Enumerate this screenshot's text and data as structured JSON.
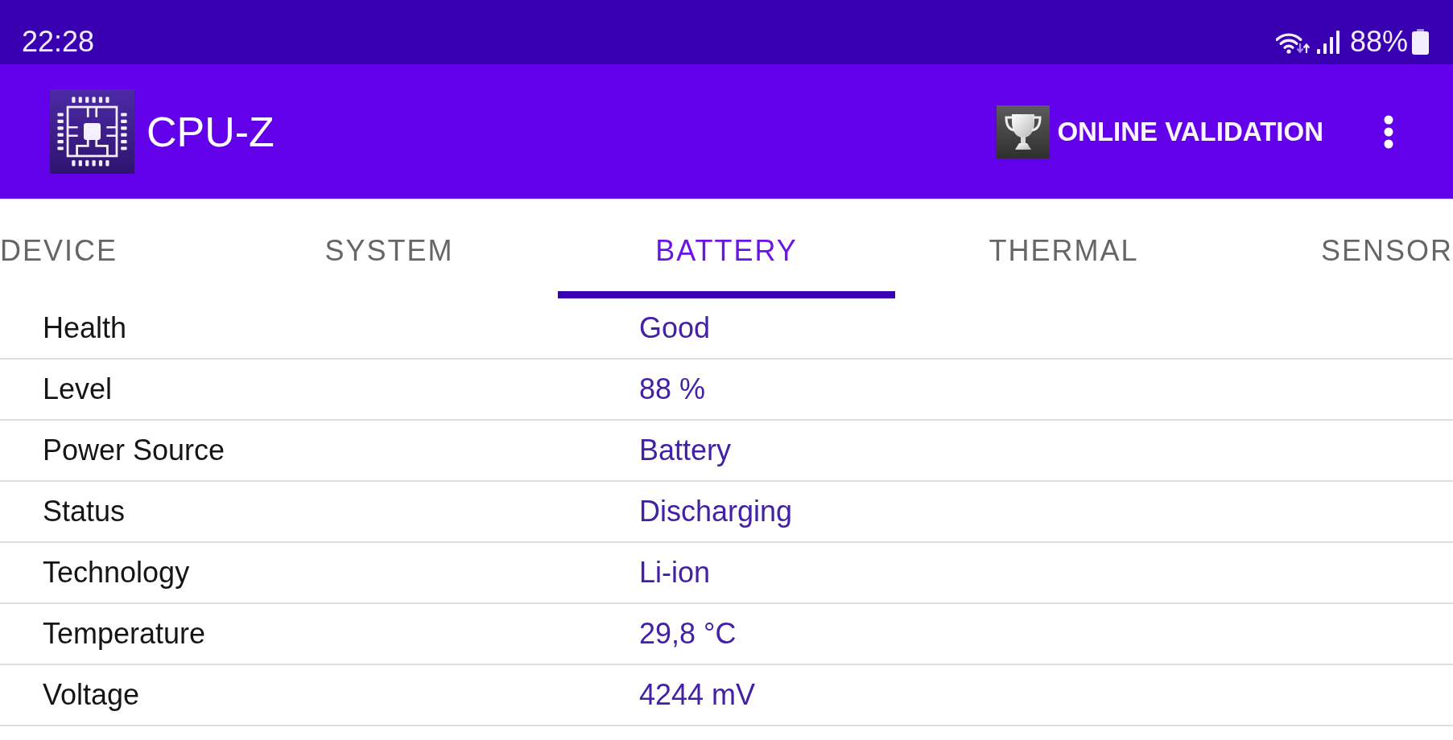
{
  "status_bar": {
    "time": "22:28",
    "battery_percent": "88%"
  },
  "app_bar": {
    "title": "CPU-Z",
    "validation_button": "ONLINE VALIDATION"
  },
  "tabs": [
    {
      "label": "DEVICE",
      "selected": false
    },
    {
      "label": "SYSTEM",
      "selected": false
    },
    {
      "label": "BATTERY",
      "selected": true
    },
    {
      "label": "THERMAL",
      "selected": false
    },
    {
      "label": "SENSOR",
      "selected": false
    }
  ],
  "battery_info": [
    {
      "label": "Health",
      "value": "Good"
    },
    {
      "label": "Level",
      "value": "88 %"
    },
    {
      "label": "Power Source",
      "value": "Battery"
    },
    {
      "label": "Status",
      "value": "Discharging"
    },
    {
      "label": "Technology",
      "value": "Li-ion"
    },
    {
      "label": "Temperature",
      "value": "29,8 °C"
    },
    {
      "label": "Voltage",
      "value": "4244 mV"
    }
  ]
}
